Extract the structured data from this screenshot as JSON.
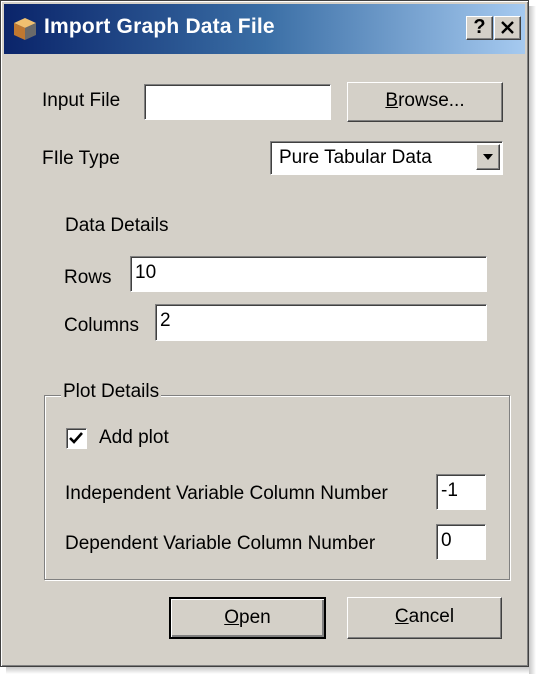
{
  "window": {
    "title": "Import Graph Data File",
    "help_button": "?",
    "close_button": "✕"
  },
  "input_file": {
    "label": "Input File",
    "value": "",
    "browse_label": "Browse...",
    "browse_mnemonic": "B",
    "browse_rest": "rowse..."
  },
  "file_type": {
    "label": "FIle Type",
    "selected": "Pure Tabular Data"
  },
  "data_details": {
    "heading": "Data Details",
    "rows_label": "Rows",
    "rows_value": "10",
    "columns_label": "Columns",
    "columns_value": "2"
  },
  "plot_details": {
    "heading": "Plot Details",
    "add_plot_label": "Add plot",
    "add_plot_checked": true,
    "independent_label": "Independent Variable Column Number",
    "independent_value": "-1",
    "dependent_label": "Dependent Variable Column Number",
    "dependent_value": "0"
  },
  "buttons": {
    "open_label": "Open",
    "open_mnemonic": "O",
    "open_rest": "pen",
    "cancel_label": "Cancel",
    "cancel_mnemonic": "C",
    "cancel_rest": "ancel"
  }
}
